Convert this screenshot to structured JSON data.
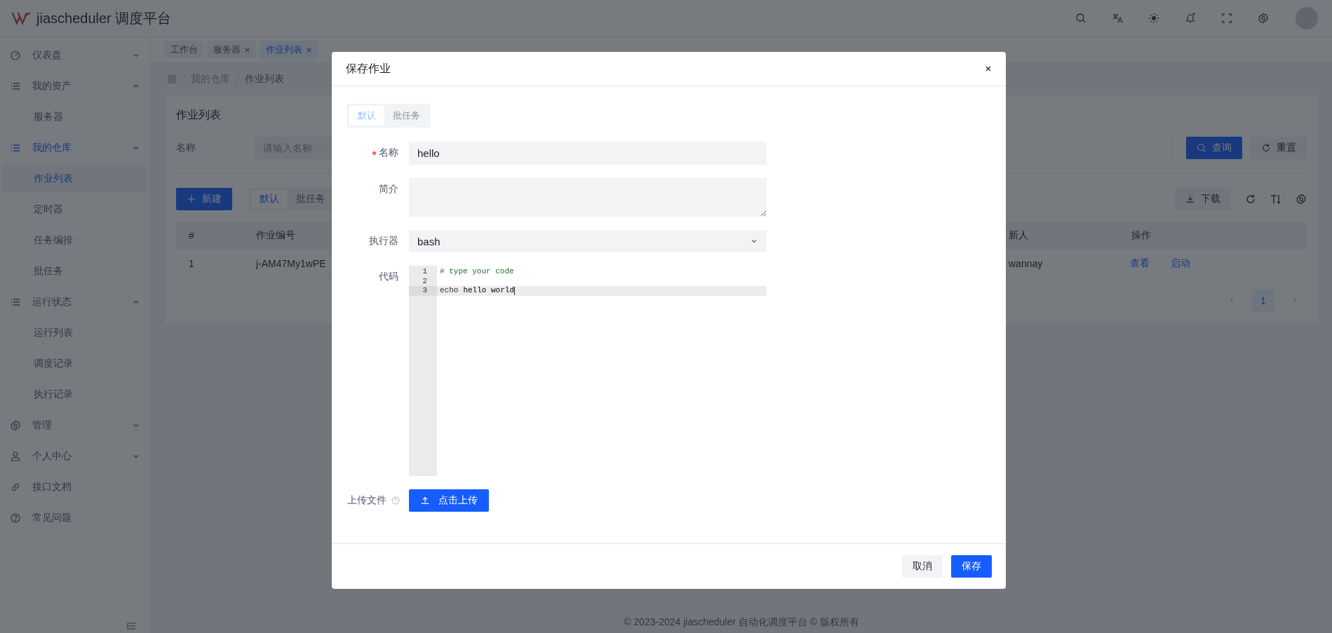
{
  "app": {
    "title": "jiascheduler 调度平台"
  },
  "sidebar": [
    {
      "label": "仪表盘",
      "expanded": false,
      "selected": false
    },
    {
      "label": "我的资产",
      "expanded": true,
      "selected": false,
      "children": [
        {
          "label": "服务器",
          "selected": false
        }
      ]
    },
    {
      "label": "我的仓库",
      "expanded": true,
      "selected": true,
      "children": [
        {
          "label": "作业列表",
          "selected": true
        },
        {
          "label": "定时器",
          "selected": false
        },
        {
          "label": "任务编排",
          "selected": false
        },
        {
          "label": "批任务",
          "selected": false
        }
      ]
    },
    {
      "label": "运行状态",
      "expanded": true,
      "selected": false,
      "children": [
        {
          "label": "运行列表",
          "selected": false
        },
        {
          "label": "调度记录",
          "selected": false
        },
        {
          "label": "执行记录",
          "selected": false
        }
      ]
    },
    {
      "label": "管理",
      "expanded": false,
      "selected": false
    },
    {
      "label": "个人中心",
      "expanded": false,
      "selected": false
    },
    {
      "label": "接口文档",
      "selected": false
    },
    {
      "label": "常见问题",
      "selected": false
    }
  ],
  "tabs": [
    {
      "label": "工作台",
      "closable": false,
      "selected": false
    },
    {
      "label": "服务器",
      "closable": true,
      "selected": false
    },
    {
      "label": "作业列表",
      "closable": true,
      "selected": true
    }
  ],
  "breadcrumb": [
    "我的仓库",
    "作业列表"
  ],
  "page": {
    "title": "作业列表",
    "search": {
      "label": "名称",
      "placeholder": "请输入名称",
      "query": "查询",
      "reset": "重置"
    },
    "new_button": "新建",
    "view_tabs": [
      {
        "label": "默认",
        "selected": true
      },
      {
        "label": "批任务",
        "selected": false
      }
    ],
    "download": "下载",
    "table": {
      "columns": [
        "#",
        "作业编号",
        "新人",
        "操作"
      ],
      "rows": [
        {
          "cells": [
            "1",
            "j-AM47My1wPE",
            "wannay"
          ],
          "actions": [
            "查看",
            "启动"
          ]
        }
      ]
    },
    "pagination": {
      "pages": [
        {
          "label": "1",
          "selected": true
        }
      ]
    }
  },
  "dialog": {
    "title": "保存作业",
    "tabs": [
      {
        "label": "默认",
        "selected": true
      },
      {
        "label": "批任务",
        "selected": false
      }
    ],
    "fields": [
      {
        "kind": "input",
        "label": "名称",
        "required": true,
        "value": "hello"
      },
      {
        "kind": "textarea",
        "label": "简介",
        "required": false
      },
      {
        "kind": "select",
        "label": "执行器",
        "required": false,
        "value": "bash"
      },
      {
        "kind": "code",
        "label": "代码",
        "required": false,
        "lines": [
          {
            "number": "1",
            "active": false,
            "tokens": [
              {
                "kind": "comment",
                "text": "# type your code"
              }
            ]
          },
          {
            "number": "2",
            "active": false
          },
          {
            "number": "3",
            "active": true,
            "tokens": [
              {
                "kind": "plain",
                "text": "echo"
              },
              {
                "kind": "strong",
                "text": "hello world"
              }
            ]
          }
        ]
      },
      {
        "kind": "upload",
        "label": "上传文件",
        "required": false,
        "help": true,
        "button": "点击上传"
      }
    ],
    "cancel": "取消",
    "save": "保存"
  },
  "footer": "© 2023-2024 jiascheduler 自动化调度平台 © 版权所有"
}
